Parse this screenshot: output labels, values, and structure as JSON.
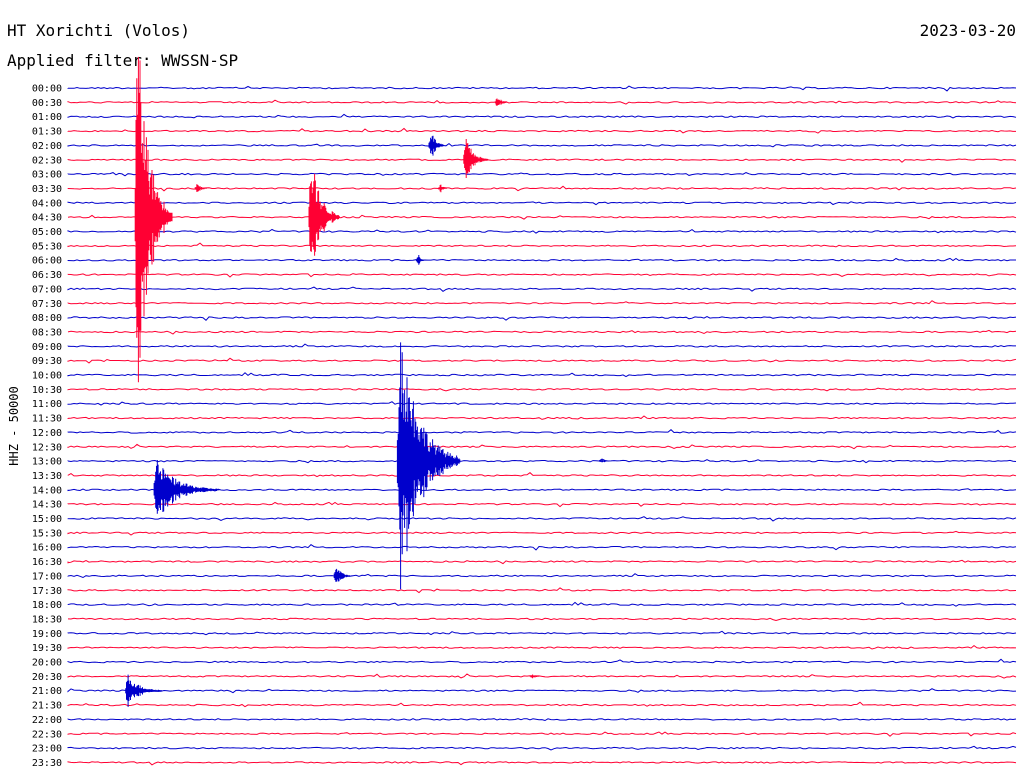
{
  "header": {
    "station": "HT Xorichti (Volos)",
    "date": "2023-03-20",
    "filter": "Applied filter: WWSSN-SP"
  },
  "chart_data": {
    "type": "line",
    "plot_kind": "helicorder",
    "ylabel": "HHZ - 50000",
    "row_labels": [
      "00:00",
      "00:30",
      "01:00",
      "01:30",
      "02:00",
      "02:30",
      "03:00",
      "03:30",
      "04:00",
      "04:30",
      "05:00",
      "05:30",
      "06:00",
      "06:30",
      "07:00",
      "07:30",
      "08:00",
      "08:30",
      "09:00",
      "09:30",
      "10:00",
      "10:30",
      "11:00",
      "11:30",
      "12:00",
      "12:30",
      "13:00",
      "13:30",
      "14:00",
      "14:30",
      "15:00",
      "15:30",
      "16:00",
      "16:30",
      "17:00",
      "17:30",
      "18:00",
      "18:30",
      "19:00",
      "19:30",
      "20:00",
      "20:30",
      "21:00",
      "21:30",
      "22:00",
      "22:30",
      "23:00",
      "23:30"
    ],
    "row_minutes": 30,
    "x_range_minutes": [
      0,
      30
    ],
    "colors": {
      "even_row": "#0000cc",
      "odd_row": "#ff0033"
    },
    "grid": false,
    "events": [
      {
        "time": "04:30",
        "minute": 2.1,
        "amplitude_rows": 14,
        "duration_min": 1.2,
        "color": "#ff0033"
      },
      {
        "time": "04:30",
        "minute": 7.6,
        "amplitude_rows": 4.5,
        "duration_min": 1.0,
        "color": "#ff0033"
      },
      {
        "time": "03:30",
        "minute": 4.0,
        "amplitude_rows": 0.4,
        "duration_min": 0.4,
        "color": "#ff0033"
      },
      {
        "time": "02:00",
        "minute": 11.4,
        "amplitude_rows": 1.1,
        "duration_min": 0.5,
        "color": "#0000cc"
      },
      {
        "time": "02:30",
        "minute": 12.5,
        "amplitude_rows": 1.6,
        "duration_min": 0.8,
        "color": "#ff0033"
      },
      {
        "time": "00:30",
        "minute": 13.5,
        "amplitude_rows": 0.5,
        "duration_min": 0.4,
        "color": "#ff0033"
      },
      {
        "time": "06:00",
        "minute": 11.0,
        "amplitude_rows": 0.4,
        "duration_min": 0.3,
        "color": "#0000cc"
      },
      {
        "time": "13:00",
        "minute": 10.4,
        "amplitude_rows": 10,
        "duration_min": 2.0,
        "color": "#0000cc"
      },
      {
        "time": "14:00",
        "minute": 2.7,
        "amplitude_rows": 2.2,
        "duration_min": 2.1,
        "color": "#0000cc"
      },
      {
        "time": "17:00",
        "minute": 8.4,
        "amplitude_rows": 0.7,
        "duration_min": 0.6,
        "color": "#0000cc"
      },
      {
        "time": "21:00",
        "minute": 1.8,
        "amplitude_rows": 1.2,
        "duration_min": 1.2,
        "color": "#0000cc"
      },
      {
        "time": "03:30",
        "minute": 11.7,
        "amplitude_rows": 0.3,
        "duration_min": 0.3,
        "color": "#ff0033"
      },
      {
        "time": "13:00",
        "minute": 16.8,
        "amplitude_rows": 0.2,
        "duration_min": 0.3,
        "color": "#0000cc"
      },
      {
        "time": "20:30",
        "minute": 14.6,
        "amplitude_rows": 0.15,
        "duration_min": 0.5,
        "color": "#ff0033"
      }
    ]
  }
}
